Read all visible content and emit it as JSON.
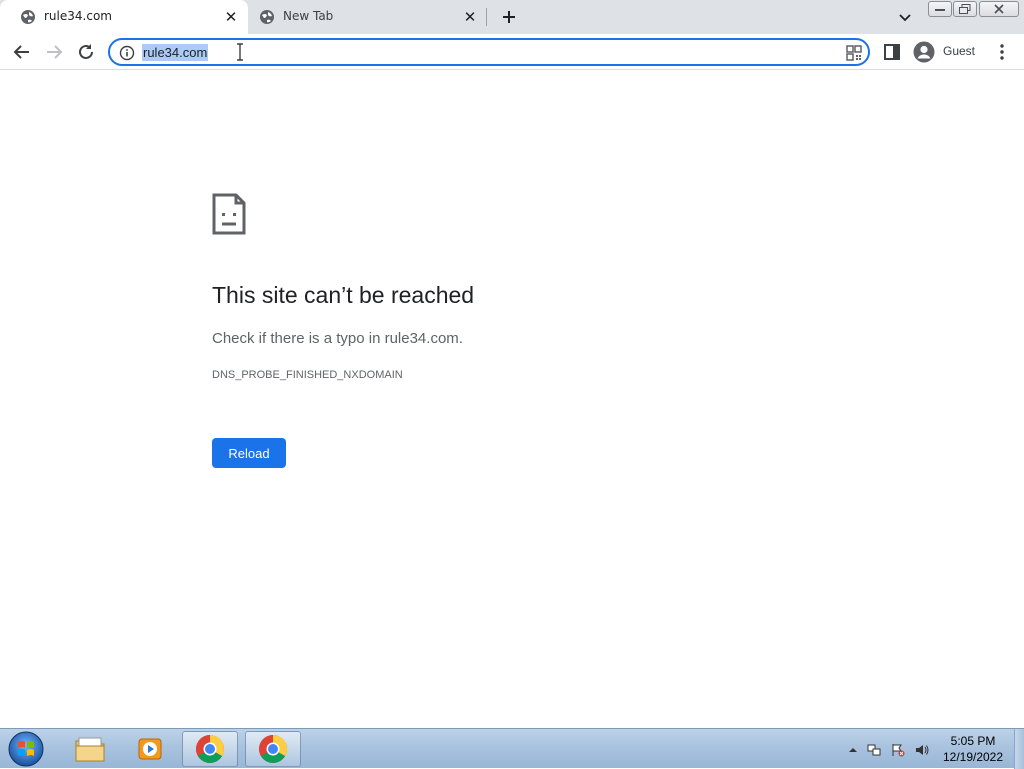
{
  "browser": {
    "tabs": [
      {
        "title": "rule34.com",
        "favicon": "globe-icon",
        "active": true
      },
      {
        "title": "New Tab",
        "favicon": "globe-icon",
        "active": false
      }
    ],
    "new_tab_icon": "plus-icon",
    "omnibox": {
      "url": "rule34.com",
      "site_info_icon": "info-icon"
    },
    "profile_label": "Guest"
  },
  "error_page": {
    "title": "This site can’t be reached",
    "description": "Check if there is a typo in rule34.com.",
    "code": "DNS_PROBE_FINISHED_NXDOMAIN",
    "reload_label": "Reload",
    "accent_color": "#1a73e8"
  },
  "taskbar": {
    "apps": [
      "start-orb",
      "windows-explorer",
      "media-player",
      "google-chrome",
      "google-chrome"
    ],
    "clock": {
      "time": "5:05 PM",
      "date": "12/19/2022"
    }
  }
}
